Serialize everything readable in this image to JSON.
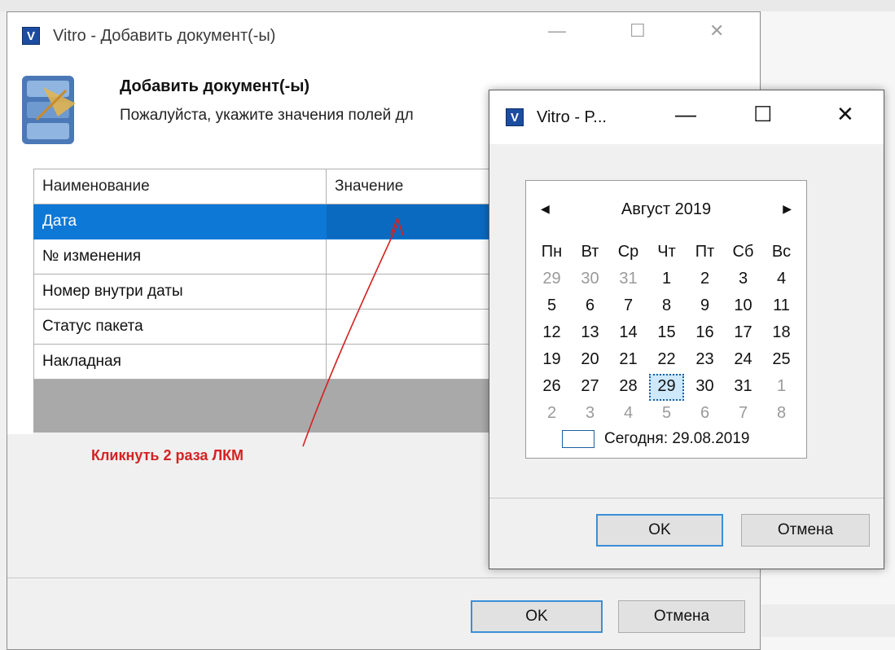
{
  "main_window": {
    "title": "Vitro - Добавить документ(-ы)",
    "app_icon_letter": "V",
    "controls": {
      "minimize": "—",
      "maximize": "☐",
      "close": "✕"
    },
    "header": {
      "title": "Добавить документ(-ы)",
      "subtitle": "Пожалуйста, укажите значения полей дл"
    },
    "grid": {
      "columns": [
        "Наименование",
        "Значение"
      ],
      "rows": [
        {
          "name": "Дата",
          "value": "",
          "selected": true
        },
        {
          "name": "№ изменения",
          "value": ""
        },
        {
          "name": "Номер внутри даты",
          "value": ""
        },
        {
          "name": "Статус пакета",
          "value": ""
        },
        {
          "name": "Накладная",
          "value": ""
        }
      ]
    },
    "buttons": {
      "ok": "OK",
      "cancel": "Отмена"
    }
  },
  "annotation": {
    "text": "Кликнуть 2 раза ЛКМ",
    "color": "#d42222"
  },
  "date_dialog": {
    "title": "Vitro - P...",
    "app_icon_letter": "V",
    "controls": {
      "minimize": "—",
      "maximize": "☐",
      "close": "✕"
    },
    "calendar": {
      "prev": "◀",
      "next": "▶",
      "month_label": "Август 2019",
      "weekdays": [
        "Пн",
        "Вт",
        "Ср",
        "Чт",
        "Пт",
        "Сб",
        "Вс"
      ],
      "weeks": [
        [
          "29",
          "30",
          "31",
          "1",
          "2",
          "3",
          "4"
        ],
        [
          "5",
          "6",
          "7",
          "8",
          "9",
          "10",
          "11"
        ],
        [
          "12",
          "13",
          "14",
          "15",
          "16",
          "17",
          "18"
        ],
        [
          "19",
          "20",
          "21",
          "22",
          "23",
          "24",
          "25"
        ],
        [
          "26",
          "27",
          "28",
          "29",
          "30",
          "31",
          "1"
        ],
        [
          "2",
          "3",
          "4",
          "5",
          "6",
          "7",
          "8"
        ]
      ],
      "today_label": "Сегодня: 29.08.2019"
    },
    "buttons": {
      "ok": "OK",
      "cancel": "Отмена"
    }
  },
  "colors": {
    "selection": "#0d78d6",
    "accent": "#3b8fd8",
    "grid_bg": "#a9a9a9"
  }
}
